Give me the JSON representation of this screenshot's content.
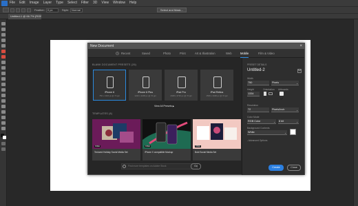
{
  "menu": [
    "File",
    "Edit",
    "Image",
    "Layer",
    "Type",
    "Select",
    "Filter",
    "3D",
    "View",
    "Window",
    "Help"
  ],
  "options_bar": {
    "feather_label": "Feather:",
    "feather_value": "0 px",
    "style_label": "Style:",
    "style_value": "Normal",
    "select_mask_label": "Select and Mask..."
  },
  "document_tab": "Untitled-1 @ 66.7% (RGB/8) *",
  "dialog": {
    "title": "New Document",
    "close": "×",
    "tabs": [
      "Recent",
      "Saved",
      "Photo",
      "Print",
      "Art & Illustration",
      "Web",
      "Mobile",
      "Film & Video"
    ],
    "active_tab": "Mobile",
    "blank_presets_label": "BLANK DOCUMENT PRESETS",
    "blank_presets_count": "(26)",
    "presets": [
      {
        "name": "iPhone 6",
        "dims": "750 x 1334 px @ 72 ppi"
      },
      {
        "name": "iPhone 6 Plus",
        "dims": "1242 x 2208 px @ 72 ppi"
      },
      {
        "name": "iPad Pro",
        "dims": "2048 x 2732 px @ 72 ppi"
      },
      {
        "name": "iPad Retina",
        "dims": "1536 x 2048 px @ 72 ppi"
      }
    ],
    "view_all": "View All Presets",
    "templates_label": "TEMPLATES",
    "templates_count": "(8)",
    "templates": [
      {
        "name": "Textured Holiday Social Media Set",
        "badge": "FREE"
      },
      {
        "name": "iPhone X compatible Mockup",
        "badge": "FREE"
      },
      {
        "name": "Bold Social Media Set",
        "badge": "FREE"
      }
    ],
    "search_placeholder": "Find more templates on Adobe Stock",
    "go_label": "Go",
    "details": {
      "header": "PRESET DETAILS",
      "name": "Untitled-2",
      "width_label": "Width",
      "width_value": "750",
      "width_unit": "Pixels",
      "height_label": "Height",
      "height_value": "1334",
      "orientation_label": "Orientation",
      "artboards_label": "Artboards",
      "resolution_label": "Resolution",
      "resolution_value": "72",
      "resolution_unit": "Pixels/Inch",
      "color_mode_label": "Color Mode",
      "color_mode_value": "RGB Color",
      "bit_depth_value": "8 bit",
      "background_label": "Background Contents",
      "background_value": "White",
      "advanced_label": "Advanced Options"
    },
    "create_label": "Create",
    "close_label": "Close"
  },
  "colors": {
    "accent": "#2b8be0",
    "create_button": "#2b7fe0"
  }
}
